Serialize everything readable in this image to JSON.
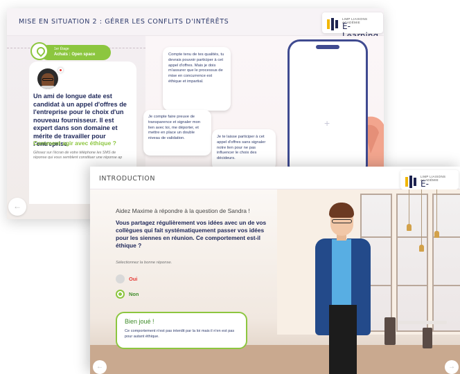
{
  "back_screen": {
    "title": "MISE EN SITUATION 2 : GÉRER LES CONFLITS D'INTÉRÊTS",
    "logo": {
      "small": "LIMP LIAISONS ACADÉMIE",
      "big": "E-Learning"
    },
    "location": {
      "floor": "1er Étage",
      "place": "Achats : Open space"
    },
    "scenario_text": "Un ami de longue date est candidat à un appel d'offres de l'entreprise pour le choix d'un nouveau fournisseur. Il est expert dans son domaine et mérite de travailler pour l'entreprise.",
    "question": "Comment agir avec éthique ?",
    "hint": "Glissez sur l'écran de votre téléphone les SMS de réponse qui vous semblent constituer une réponse ap",
    "bubbles": [
      "Compte tenu de tes qualités, tu devrais pouvoir participer à cet appel d'offres. Mais je dois m'assurer que le processus de mise en concurrence est éthique et impartial.",
      "Je compte faire preuve de transparence et signaler mon lien avec toi, me déporter, et mettre en place un double niveau de validation.",
      "Je te laisse participer à cet appel d'offres sans signaler notre lien pour ne pas influencer le choix des décideurs."
    ],
    "phone_plus": "+",
    "prev_arrow": "←"
  },
  "front_screen": {
    "title": "INTRODUCTION",
    "logo": {
      "small": "LIMP LIAISONS ACADÉMIE",
      "big": "E-Learning"
    },
    "help_line": "Aidez Maxime à répondre à la question de Sandra !",
    "question": "Vous partagez régulièrement vos idées avec un de vos collègues qui fait systématiquement passer vos idées pour les siennes en réunion. Ce comportement est-il éthique ?",
    "select_hint": "Sélectionnez la bonne réponse.",
    "options": [
      {
        "label": "Oui",
        "selected": false
      },
      {
        "label": "Non",
        "selected": true
      }
    ],
    "feedback": {
      "title": "Bien joué !",
      "message": "Ce comportement n'est pas interdit par la loi mais il n'en est pas pour autant éthique."
    },
    "prev_arrow": "←",
    "next_arrow": "→"
  },
  "colors": {
    "accent_green": "#8cc63f",
    "navy_text": "#20295a",
    "wrong_red": "#e53935"
  }
}
